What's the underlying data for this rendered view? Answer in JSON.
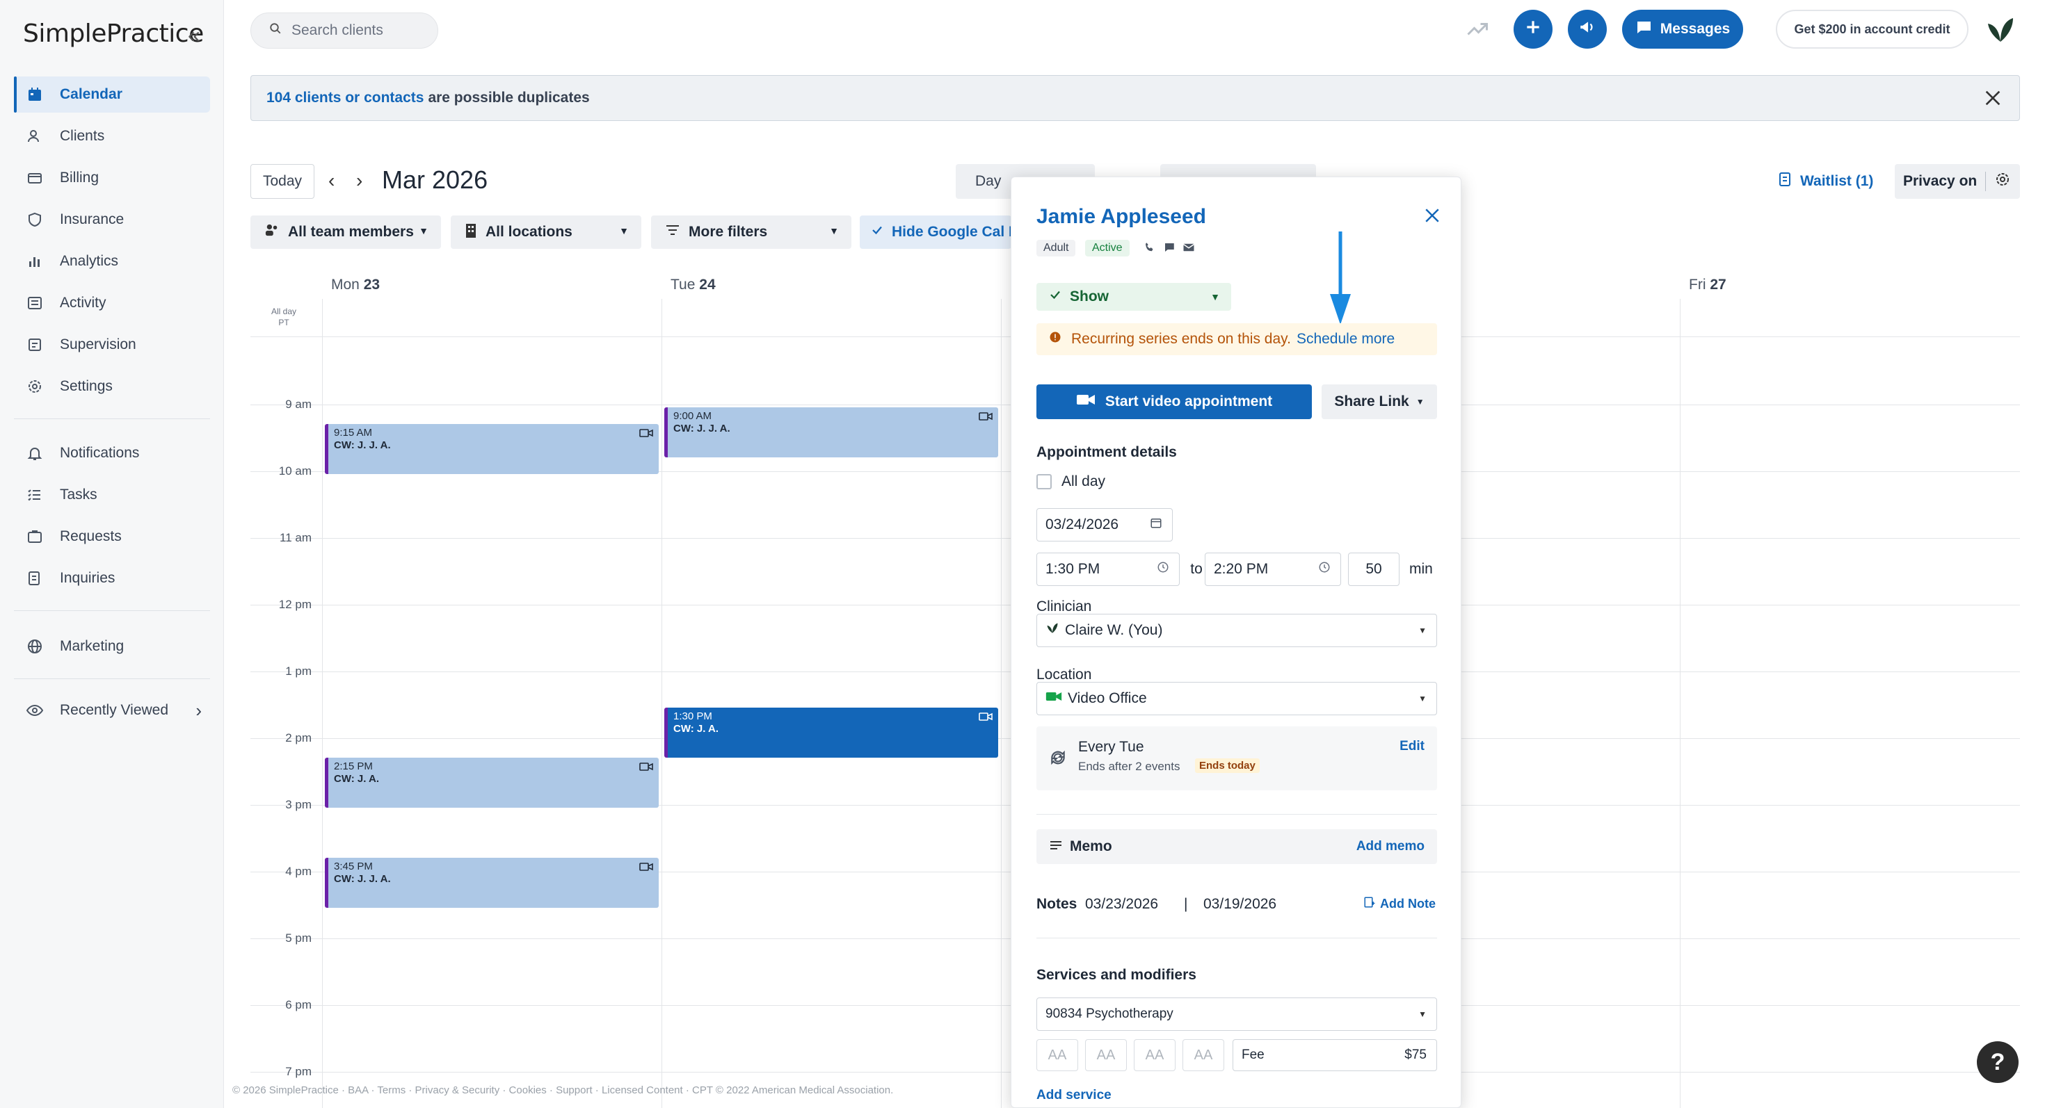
{
  "app": {
    "logo": "SimplePractice"
  },
  "sidebar": {
    "items": [
      {
        "label": "Calendar",
        "icon": "calendar-icon"
      },
      {
        "label": "Clients",
        "icon": "users-icon"
      },
      {
        "label": "Billing",
        "icon": "billing-icon"
      },
      {
        "label": "Insurance",
        "icon": "shield-icon"
      },
      {
        "label": "Analytics",
        "icon": "chart-icon"
      },
      {
        "label": "Activity",
        "icon": "activity-icon"
      },
      {
        "label": "Supervision",
        "icon": "supervision-icon"
      },
      {
        "label": "Settings",
        "icon": "gear-icon"
      },
      {
        "label": "Notifications",
        "icon": "bell-icon"
      },
      {
        "label": "Tasks",
        "icon": "tasks-icon"
      },
      {
        "label": "Requests",
        "icon": "requests-icon"
      },
      {
        "label": "Inquiries",
        "icon": "inquiries-icon"
      },
      {
        "label": "Marketing",
        "icon": "globe-icon"
      },
      {
        "label": "Recently Viewed",
        "icon": "eye-icon"
      }
    ]
  },
  "topbar": {
    "search_placeholder": "Search clients",
    "messages_label": "Messages",
    "credit_label": "Get $200 in account credit"
  },
  "banner": {
    "link": "104 clients or contacts",
    "text": "are possible duplicates"
  },
  "toolbar": {
    "today": "Today",
    "month": "Mar 2026",
    "view_day": "Day",
    "waitlist": "Waitlist (1)",
    "privacy": "Privacy on",
    "filters": [
      "All team members",
      "All locations",
      "More filters",
      "Hide Google Cal E"
    ]
  },
  "calendar": {
    "days": [
      {
        "name": "Mon",
        "num": "23"
      },
      {
        "name": "Tue",
        "num": "24"
      },
      {
        "name": "Fri",
        "num": "27"
      }
    ],
    "allday": "All day",
    "tz": "PT",
    "hours": [
      "9 am",
      "10 am",
      "11 am",
      "12 pm",
      "1 pm",
      "2 pm",
      "3 pm",
      "4 pm",
      "5 pm",
      "6 pm",
      "7 pm"
    ],
    "appointments": [
      {
        "time": "9:15 AM",
        "client": "CW: J. J. A."
      },
      {
        "time": "9:00 AM",
        "client": "CW: J. J. A."
      },
      {
        "time": "1:30 PM",
        "client": "CW: J. A."
      },
      {
        "time": "2:15 PM",
        "client": "CW: J. A."
      },
      {
        "time": "3:45 PM",
        "client": "CW: J. J. A."
      }
    ]
  },
  "footer": "© 2026 SimplePractice · BAA · Terms · Privacy & Security · Cookies · Support · Licensed Content · CPT © 2022 American Medical Association.",
  "popup": {
    "name": "Jamie Appleseed",
    "tag_adult": "Adult",
    "tag_active": "Active",
    "status": "Show",
    "recur_warning": "Recurring series ends on this day.",
    "schedule_more": "Schedule more",
    "start_video": "Start video appointment",
    "share_link": "Share Link",
    "details_title": "Appointment details",
    "all_day": "All day",
    "date": "03/24/2026",
    "start_time": "1:30 PM",
    "to": "to",
    "end_time": "2:20 PM",
    "duration": "50",
    "min": "min",
    "clinician_label": "Clinician",
    "clinician": "Claire W. (You)",
    "location_label": "Location",
    "location": "Video Office",
    "repeat": "Every Tue",
    "repeat_sub": "Ends after 2 events",
    "ends_today": "Ends today",
    "edit": "Edit",
    "memo": "Memo",
    "add_memo": "Add memo",
    "notes_label": "Notes",
    "note1": "03/23/2026",
    "note_sep": "|",
    "note2": "03/19/2026",
    "add_note": "Add Note",
    "services_title": "Services and modifiers",
    "service": "90834 Psychotherapy",
    "modifiers": [
      "AA",
      "AA",
      "AA",
      "AA"
    ],
    "fee_label": "Fee",
    "fee": "$75",
    "add_service": "Add service"
  },
  "help": "?"
}
